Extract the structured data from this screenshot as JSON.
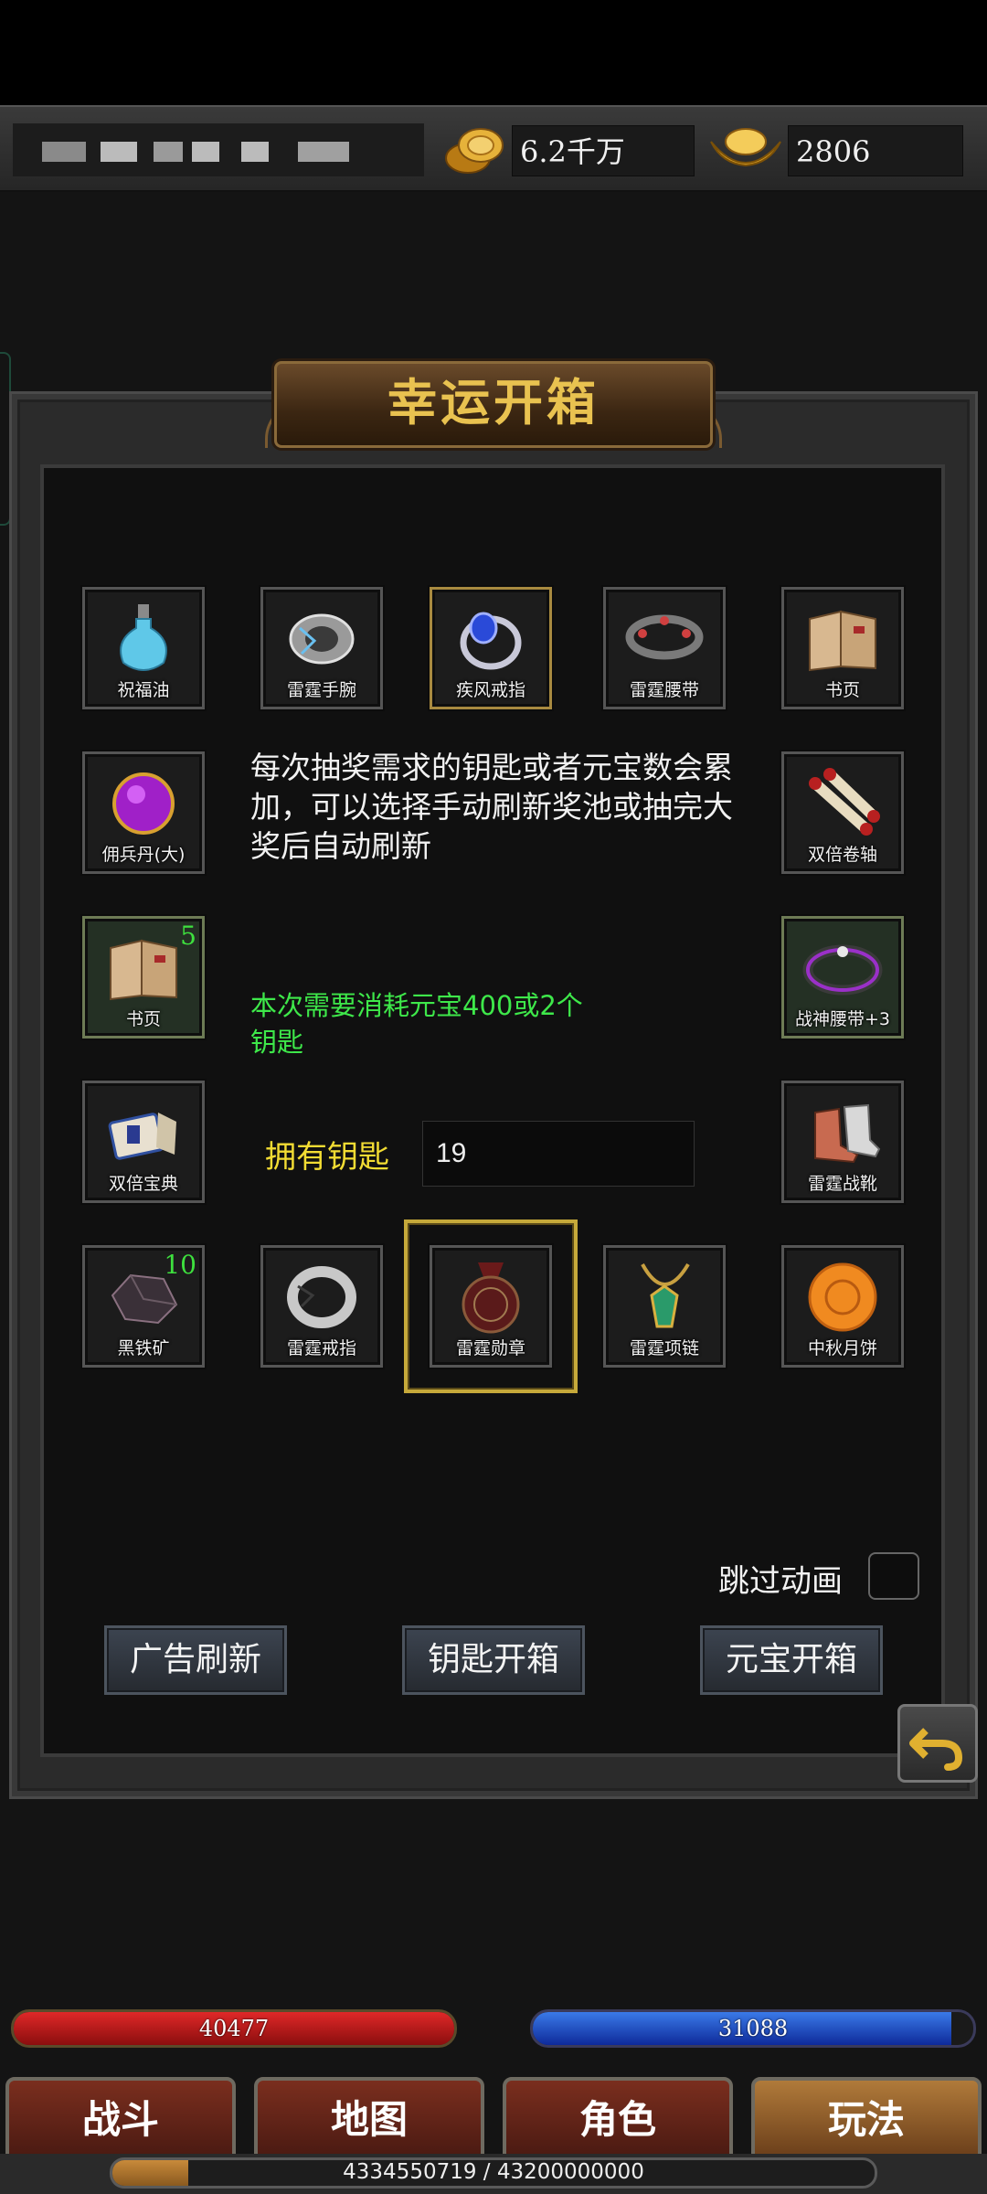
{
  "header": {
    "gold_amount": "6.2千万",
    "ingot_amount": "2806"
  },
  "panel": {
    "title": "幸运开箱",
    "description": "每次抽奖需求的钥匙或者元宝数会累加，可以选择手动刷新奖池或抽完大奖后自动刷新",
    "cost_text": "本次需要消耗元宝400或2个钥匙",
    "keys_label": "拥有钥匙",
    "keys_value": "19",
    "skip_animation_label": "跳过动画",
    "buttons": {
      "ad_refresh": "广告刷新",
      "key_open": "钥匙开箱",
      "ingot_open": "元宝开箱"
    }
  },
  "items": [
    {
      "label": "祝福油"
    },
    {
      "label": "雷霆手腕"
    },
    {
      "label": "疾风戒指"
    },
    {
      "label": "雷霆腰带"
    },
    {
      "label": "书页"
    },
    {
      "label": "佣兵丹(大)"
    },
    {
      "label": "双倍卷轴"
    },
    {
      "label": "书页",
      "count": "5"
    },
    {
      "label": "战神腰带+3"
    },
    {
      "label": "双倍宝典"
    },
    {
      "label": "雷霆战靴"
    },
    {
      "label": "黑铁矿",
      "count": "10"
    },
    {
      "label": "雷霆戒指"
    },
    {
      "label": "雷霆勋章"
    },
    {
      "label": "雷霆项链"
    },
    {
      "label": "中秋月饼"
    }
  ],
  "status": {
    "hp": "40477",
    "mp": "31088",
    "hp_fill": 1.0,
    "mp_fill": 0.95,
    "exp_text": "4334550719 / 43200000000",
    "exp_fill": 0.1
  },
  "tabs": [
    "战斗",
    "地图",
    "角色",
    "玩法"
  ],
  "colors": {
    "title_gold": "#e9c250",
    "cost_green": "#3ee84a",
    "keys_yellow": "#f2dc33",
    "hp_red": "#c41a1a",
    "mp_blue": "#1a4ad0"
  }
}
